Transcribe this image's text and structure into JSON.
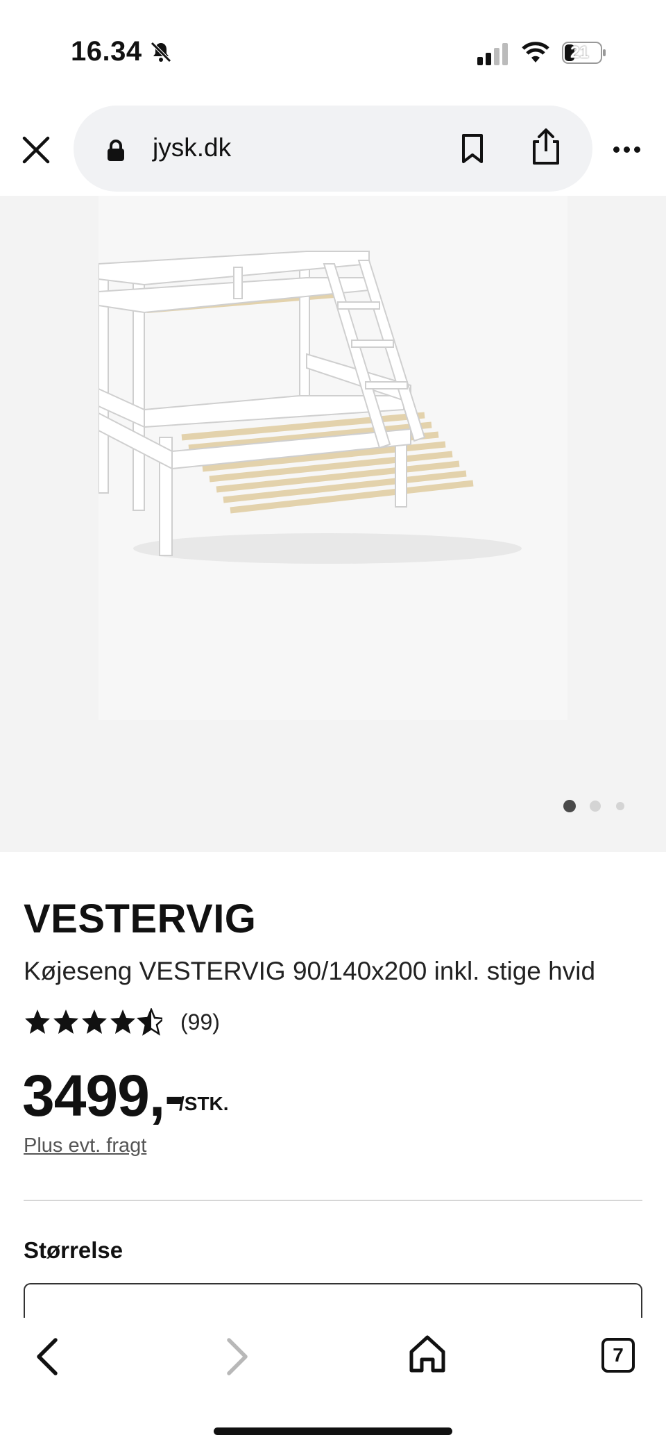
{
  "status_bar": {
    "time": "16.34",
    "battery_level": "21",
    "icons": [
      "bell-slash-icon",
      "cellular-signal-icon",
      "wifi-icon",
      "battery-icon"
    ]
  },
  "browser": {
    "url": "jysk.dk",
    "icons": [
      "close-icon",
      "lock-icon",
      "bookmark-icon",
      "share-icon",
      "more-icon"
    ]
  },
  "gallery": {
    "image_alt": "bunk-bed-image",
    "dot_count": 3,
    "active_dot": 0,
    "active_dot_color": "#4a4a4a",
    "inactive_dot_color": "#d4d4d4"
  },
  "product": {
    "name": "VESTERVIG",
    "description": "Køjeseng VESTERVIG 90/140x200 inkl. stige hvid",
    "rating": 4.5,
    "rating_max": 5,
    "review_count": "(99)",
    "price": "3499,-",
    "unit": "/STK.",
    "freight_note": "Plus evt. fragt",
    "size_label": "Størrelse"
  },
  "toolbar": {
    "tab_count": "7",
    "icons": [
      "back-icon",
      "forward-icon",
      "home-icon",
      "tabs-icon"
    ]
  }
}
